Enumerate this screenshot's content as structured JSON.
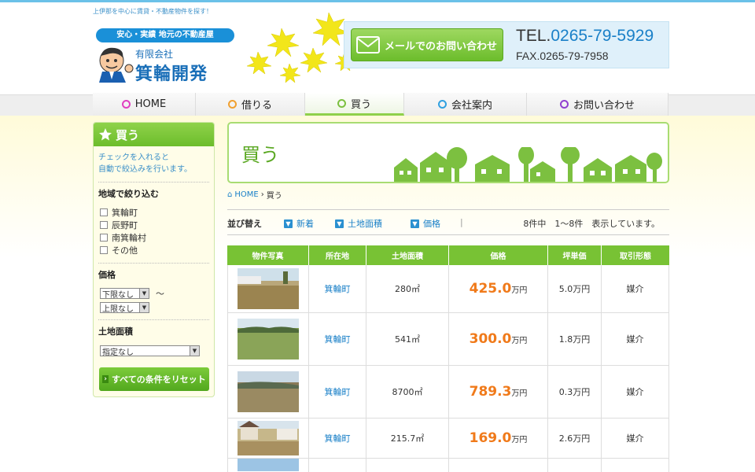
{
  "header": {
    "tagline": "上伊那を中心に賃貸・不動産物件を探す！",
    "slogan": "安心・実績 地元の不動産屋",
    "company_sub": "有限会社",
    "company_name": "箕輪開発",
    "mail_button": "メールでのお問い合わせ",
    "tel_prefix": "TEL.",
    "tel_number": "0265-79-5929",
    "fax": "FAX.0265-79-7958"
  },
  "nav": {
    "items": [
      {
        "label": "HOME",
        "color": "#e040c0"
      },
      {
        "label": "借りる",
        "color": "#f0a030"
      },
      {
        "label": "買う",
        "color": "#7cc040"
      },
      {
        "label": "会社案内",
        "color": "#30a0e0"
      },
      {
        "label": "お問い合わせ",
        "color": "#9040d0"
      }
    ],
    "active": "買う"
  },
  "sidebar": {
    "title": "買う",
    "note_line1": "チェックを入れると",
    "note_line2": "自動で絞込みを行います。",
    "area_title": "地域で絞り込む",
    "areas": [
      "箕輪町",
      "辰野町",
      "南箕輪村",
      "その他"
    ],
    "price_title": "価格",
    "price_min": "下限なし",
    "price_tilde": "〜",
    "price_max": "上限なし",
    "land_title": "土地面積",
    "land_select": "指定なし",
    "reset_button": "すべての条件をリセット"
  },
  "banner": {
    "title": "買う"
  },
  "breadcrumb": {
    "home": "HOME",
    "current": "買う"
  },
  "sortbar": {
    "label": "並び替え",
    "options": [
      "新着",
      "土地面積",
      "価格"
    ],
    "count": "8件中　1〜8件　表示しています。"
  },
  "table": {
    "headers": [
      "物件写真",
      "所在地",
      "土地面積",
      "価格",
      "坪単価",
      "取引形態"
    ],
    "rows": [
      {
        "location": "箕輪町",
        "area": "280㎡",
        "price": "425.0",
        "unit": "万円",
        "tsubo": "5.0万円",
        "type": "媒介"
      },
      {
        "location": "箕輪町",
        "area": "541㎡",
        "price": "300.0",
        "unit": "万円",
        "tsubo": "1.8万円",
        "type": "媒介"
      },
      {
        "location": "箕輪町",
        "area": "8700㎡",
        "price": "789.3",
        "unit": "万円",
        "tsubo": "0.3万円",
        "type": "媒介"
      },
      {
        "location": "箕輪町",
        "area": "215.7㎡",
        "price": "169.0",
        "unit": "万円",
        "tsubo": "2.6万円",
        "type": "媒介"
      }
    ]
  },
  "colors": {
    "accent_green": "#78c234",
    "accent_blue": "#1a80c8",
    "price_orange": "#f07a1a"
  }
}
